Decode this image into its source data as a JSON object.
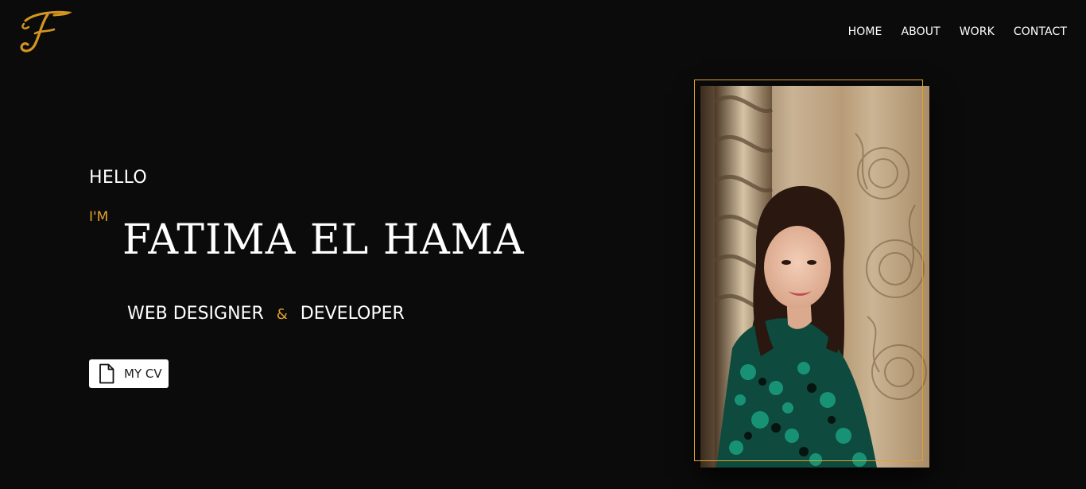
{
  "brand": {
    "logo_letter": "F",
    "accent_color": "#e0a12b"
  },
  "nav": {
    "items": [
      {
        "label": "HOME"
      },
      {
        "label": "ABOUT"
      },
      {
        "label": "WORK"
      },
      {
        "label": "CONTACT"
      }
    ]
  },
  "hero": {
    "greeting": "HELLO",
    "im": "I'M",
    "name": "FATIMA EL HAMA",
    "role_left": "WEB DESIGNER",
    "role_amp": "&",
    "role_right": "DEVELOPER",
    "cv_label": "MY CV",
    "cv_icon": "document-icon"
  },
  "photo": {
    "subject": "portrait-photo"
  }
}
